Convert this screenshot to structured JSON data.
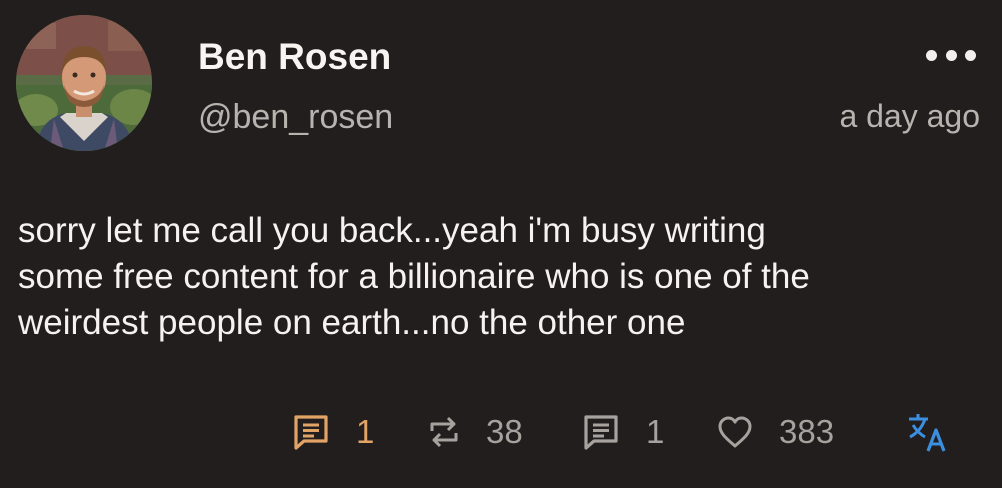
{
  "post": {
    "author": {
      "display_name": "Ben Rosen",
      "handle": "@ben_rosen"
    },
    "timestamp": "a day ago",
    "text": "sorry let me call you back...yeah i'm busy writing\nsome free content for a billionaire who is one of the\nweirdest people on earth...no the other one",
    "actions": {
      "comments": {
        "count": "1",
        "icon": "comment-icon",
        "color": "#e2a366"
      },
      "reposts": {
        "count": "38",
        "icon": "repost-icon",
        "color": "#a8a29f"
      },
      "quotes": {
        "count": "1",
        "icon": "quote-icon",
        "color": "#a8a29f"
      },
      "likes": {
        "count": "383",
        "icon": "heart-icon",
        "color": "#a8a29f"
      },
      "translate": {
        "icon": "translate-icon",
        "color": "#3b8fe0"
      }
    },
    "more_icon": "more-horizontal-icon"
  },
  "colors": {
    "background": "#221e1d",
    "text": "#f5f2f0",
    "muted": "#b9b3b0",
    "accent": "#e2a366",
    "link": "#3b8fe0"
  }
}
